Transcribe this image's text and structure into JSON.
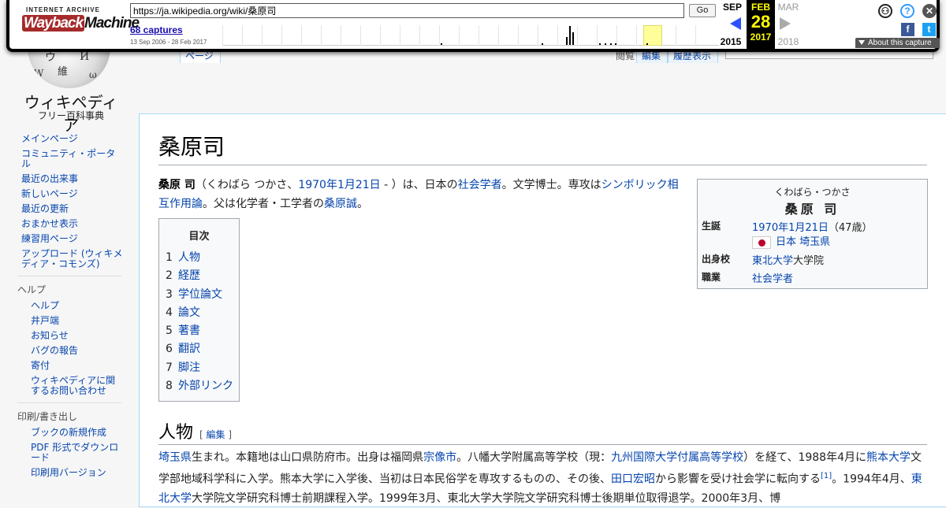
{
  "wayback": {
    "logo_top": "INTERNET ARCHIVE",
    "logo_main_a": "Wayback",
    "logo_main_b": "Machine",
    "url": "https://ja.wikipedia.org/wiki/桑原司",
    "go_label": "Go",
    "captures_label": "68 captures",
    "date_range": "13 Sep 2006 - 28 Feb 2017",
    "prev_month": "SEP",
    "prev_year": "2015",
    "cur_month": "FEB",
    "cur_day": "28",
    "cur_year": "2017",
    "next_month": "MAR",
    "next_year": "2018",
    "about_label": "About this capture",
    "user_icon": "user-icon",
    "help_icon": "help-icon",
    "close_icon": "close-icon",
    "facebook_label": "f",
    "twitter_label": "t"
  },
  "wiki": {
    "name": "ウィキペディア",
    "tagline": "フリー百科事典",
    "globe_glyphs": [
      "ウ",
      "И",
      "維",
      "W",
      "ω"
    ]
  },
  "tabs": {
    "article": "ページ",
    "edit": "編集",
    "history": "履歴表示",
    "read": "閲覧"
  },
  "sidebar": {
    "items": [
      "メインページ",
      "コミュニティ・ポータル",
      "最近の出来事",
      "新しいページ",
      "最近の更新",
      "おまかせ表示",
      "練習用ページ",
      "アップロード (ウィキメディア・コモンズ)"
    ],
    "help_heading": "ヘルプ",
    "help_items": [
      "ヘルプ",
      "井戸端",
      "お知らせ",
      "バグの報告",
      "寄付",
      "ウィキペディアに関するお問い合わせ"
    ],
    "print_heading": "印刷/書き出し",
    "print_items": [
      "ブックの新規作成",
      "PDF 形式でダウンロード",
      "印刷用バージョン"
    ]
  },
  "article": {
    "title": "桑原司",
    "lead": {
      "name": "桑原 司",
      "reading": "（くわばら つかさ、",
      "birth_link": "1970年1月21日",
      "after_birth": " - ）は、日本の",
      "sociologist_link": "社会学者",
      "after_soc": "。文学博士。専攻は",
      "si_link": "シンボリック相互作用論",
      "after_si": "。父は化学者・工学者の",
      "father_link": "桑原誠",
      "end": "。"
    },
    "infobox": {
      "kana": "くわばら・つかさ",
      "name": "桑原 司",
      "birth_key": "生誕",
      "birth_date_link": "1970年1月21日",
      "birth_age": "（47歳）",
      "birth_place_link": "日本 埼玉県",
      "school_key": "出身校",
      "school_link": "東北大学",
      "school_suffix": "大学院",
      "job_key": "職業",
      "job_link": "社会学者"
    },
    "toc": {
      "title": "目次",
      "items": [
        {
          "num": "1",
          "label": "人物"
        },
        {
          "num": "2",
          "label": "経歴"
        },
        {
          "num": "3",
          "label": "学位論文"
        },
        {
          "num": "4",
          "label": "論文"
        },
        {
          "num": "5",
          "label": "著書"
        },
        {
          "num": "6",
          "label": "翻訳"
        },
        {
          "num": "7",
          "label": "脚注"
        },
        {
          "num": "8",
          "label": "外部リンク"
        }
      ]
    },
    "section1": {
      "heading": "人物",
      "edit_open": "[ ",
      "edit_label": "編集",
      "edit_close": " ]",
      "p1": {
        "l1": "埼玉県",
        "t1": "生まれ。本籍地は山口県防府市。出身は福岡県",
        "l2": "宗像市",
        "t2": "。八幡大学附属高等学校（現：",
        "l3": "九州国際大学付属高等学校",
        "t3": "）を経て、1988年4月に",
        "l4": "熊本大学",
        "t4": "文学部地域科学科に入学。熊本大学に入学後、当初は日本民俗学を専攻するものの、その後、",
        "l5": "田口宏昭",
        "t5": "から影響を受け社会学に転向する",
        "ref": "[1]",
        "t6": "。1994年4月、",
        "l6": "東北大学",
        "t7": "大学院文学研究科博士前期課程入学。1999年3月、東北大学大学院文学研究科博士後期単位取得退学。2000年3月、博"
      }
    }
  }
}
